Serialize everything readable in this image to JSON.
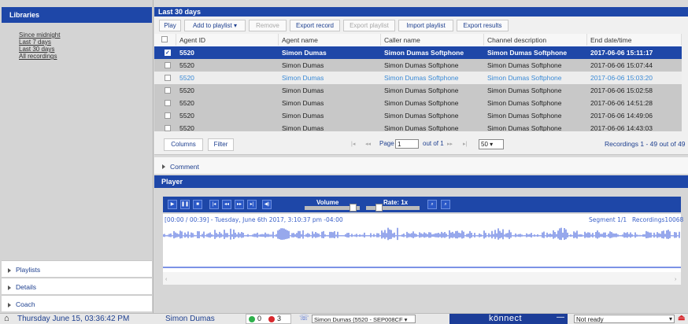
{
  "libraries": {
    "title": "Libraries",
    "links": [
      "Since midnight",
      "Last 7 days",
      "Last 30 days",
      "All recordings"
    ],
    "accordion": [
      "Playlists",
      "Details",
      "Coach"
    ]
  },
  "main": {
    "title": "Last 30 days",
    "toolbar": {
      "play": "Play",
      "add_to_playlist": "Add to playlist",
      "remove": "Remove",
      "export_record": "Export record",
      "export_playlist": "Export playlist",
      "import_playlist": "Import playlist",
      "export_results": "Export results"
    },
    "columns": [
      "Agent ID",
      "Agent name",
      "Caller name",
      "Channel description",
      "End date/time"
    ],
    "rows": [
      {
        "agent_id": "5520",
        "agent_name": "Simon Dumas",
        "caller": "Simon Dumas Softphone",
        "channel": "Simon Dumas Softphone",
        "end": "2017-06-06 15:11:17",
        "checked": true,
        "state": "selected"
      },
      {
        "agent_id": "5520",
        "agent_name": "Simon Dumas",
        "caller": "Simon Dumas Softphone",
        "channel": "Simon Dumas Softphone",
        "end": "2017-06-06 15:07:44",
        "checked": false,
        "state": "odd"
      },
      {
        "agent_id": "5520",
        "agent_name": "Simon Dumas",
        "caller": "Simon Dumas Softphone",
        "channel": "Simon Dumas Softphone",
        "end": "2017-06-06 15:03:20",
        "checked": false,
        "state": "even"
      },
      {
        "agent_id": "5520",
        "agent_name": "Simon Dumas",
        "caller": "Simon Dumas Softphone",
        "channel": "Simon Dumas Softphone",
        "end": "2017-06-06 15:02:58",
        "checked": false,
        "state": "odd"
      },
      {
        "agent_id": "5520",
        "agent_name": "Simon Dumas",
        "caller": "Simon Dumas Softphone",
        "channel": "Simon Dumas Softphone",
        "end": "2017-06-06 14:51:28",
        "checked": false,
        "state": "odd"
      },
      {
        "agent_id": "5520",
        "agent_name": "Simon Dumas",
        "caller": "Simon Dumas Softphone",
        "channel": "Simon Dumas Softphone",
        "end": "2017-06-06 14:49:06",
        "checked": false,
        "state": "odd"
      },
      {
        "agent_id": "5520",
        "agent_name": "Simon Dumas",
        "caller": "Simon Dumas Softphone",
        "channel": "Simon Dumas Softphone",
        "end": "2017-06-06 14:43:03",
        "checked": false,
        "state": "odd"
      }
    ],
    "pager": {
      "columns_btn": "Columns",
      "filter_btn": "Filter",
      "page_label": "Page",
      "page_value": "1",
      "out_of": "out of 1",
      "page_size": "50",
      "summary": "Recordings 1 - 49 out of 49"
    },
    "comment_label": "Comment"
  },
  "player": {
    "title": "Player",
    "volume_label": "Volume",
    "rate_label": "Rate: 1x",
    "info_left": "[00:00 / 00:39] - Tuesday, June 6th 2017, 3:10:37 pm -04:00",
    "segment": "Segment 1/1",
    "recording_id": "Recordings10068"
  },
  "status": {
    "datetime": "Thursday June 15, 03:36:42 PM",
    "user": "Simon Dumas",
    "green_count": "0",
    "red_count": "3",
    "phone_select": "Simon Dumas (5520 - SEP008CF",
    "brand": "könnect",
    "dash": "—",
    "availability": "Not ready"
  },
  "colors": {
    "accent": "#1e47a8",
    "brand_bg": "#1c3d98",
    "waveform": "#2f50d8"
  }
}
